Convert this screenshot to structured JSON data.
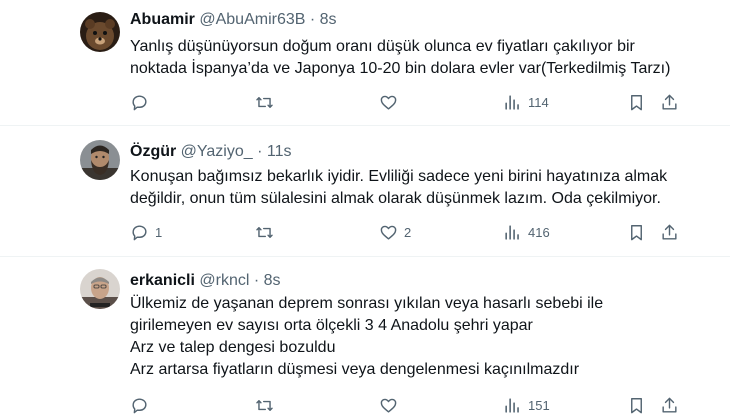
{
  "tweets": [
    {
      "name": "Abuamir",
      "handle": "@AbuAmir63B",
      "dot": "·",
      "time": "8s",
      "lines": [
        "Yanlış düşünüyorsun doğum oranı düşük olunca ev fiyatları çakılıyor bir",
        "noktada İspanya’da ve Japonya 10-20 bin dolara evler var(Terkedilmiş Tarzı)"
      ],
      "replies": "",
      "retweets": "",
      "likes": "",
      "views": "114",
      "avatar_icon": "bear-avatar"
    },
    {
      "name": "Özgür",
      "handle": "@Yaziyo_",
      "dot": "·",
      "time": "11s",
      "lines": [
        "Konuşan bağımsız bekarlık iyidir. Evliliği sadece yeni birini hayatınıza almak",
        "değildir, onun tüm sülalesini almak olarak düşünmek lazım. Oda çekilmiyor."
      ],
      "replies": "1",
      "retweets": "",
      "likes": "2",
      "views": "416",
      "avatar_icon": "bearded-man-avatar"
    },
    {
      "name": "erkanicli",
      "handle": "@rkncl",
      "dot": "·",
      "time": "8s",
      "lines": [
        "Ülkemiz de yaşanan deprem sonrası  yıkılan veya hasarlı sebebi ile",
        "girilemeyen ev sayısı orta ölçekli 3 4 Anadolu şehri yapar",
        "Arz ve talep dengesi bozuldu",
        "Arz artarsa fiyatların düşmesi veya dengelenmesi kaçınılmazdır"
      ],
      "replies": "",
      "retweets": "",
      "likes": "",
      "views": "151",
      "avatar_icon": "man-portrait-avatar"
    }
  ],
  "icons": {
    "reply": "reply-icon",
    "retweet": "retweet-icon",
    "like": "like-icon",
    "views": "views-icon",
    "bookmark": "bookmark-icon",
    "share": "share-icon"
  },
  "colors": {
    "text": "#0f1419",
    "secondary": "#536471",
    "divider": "#eff3f4"
  }
}
